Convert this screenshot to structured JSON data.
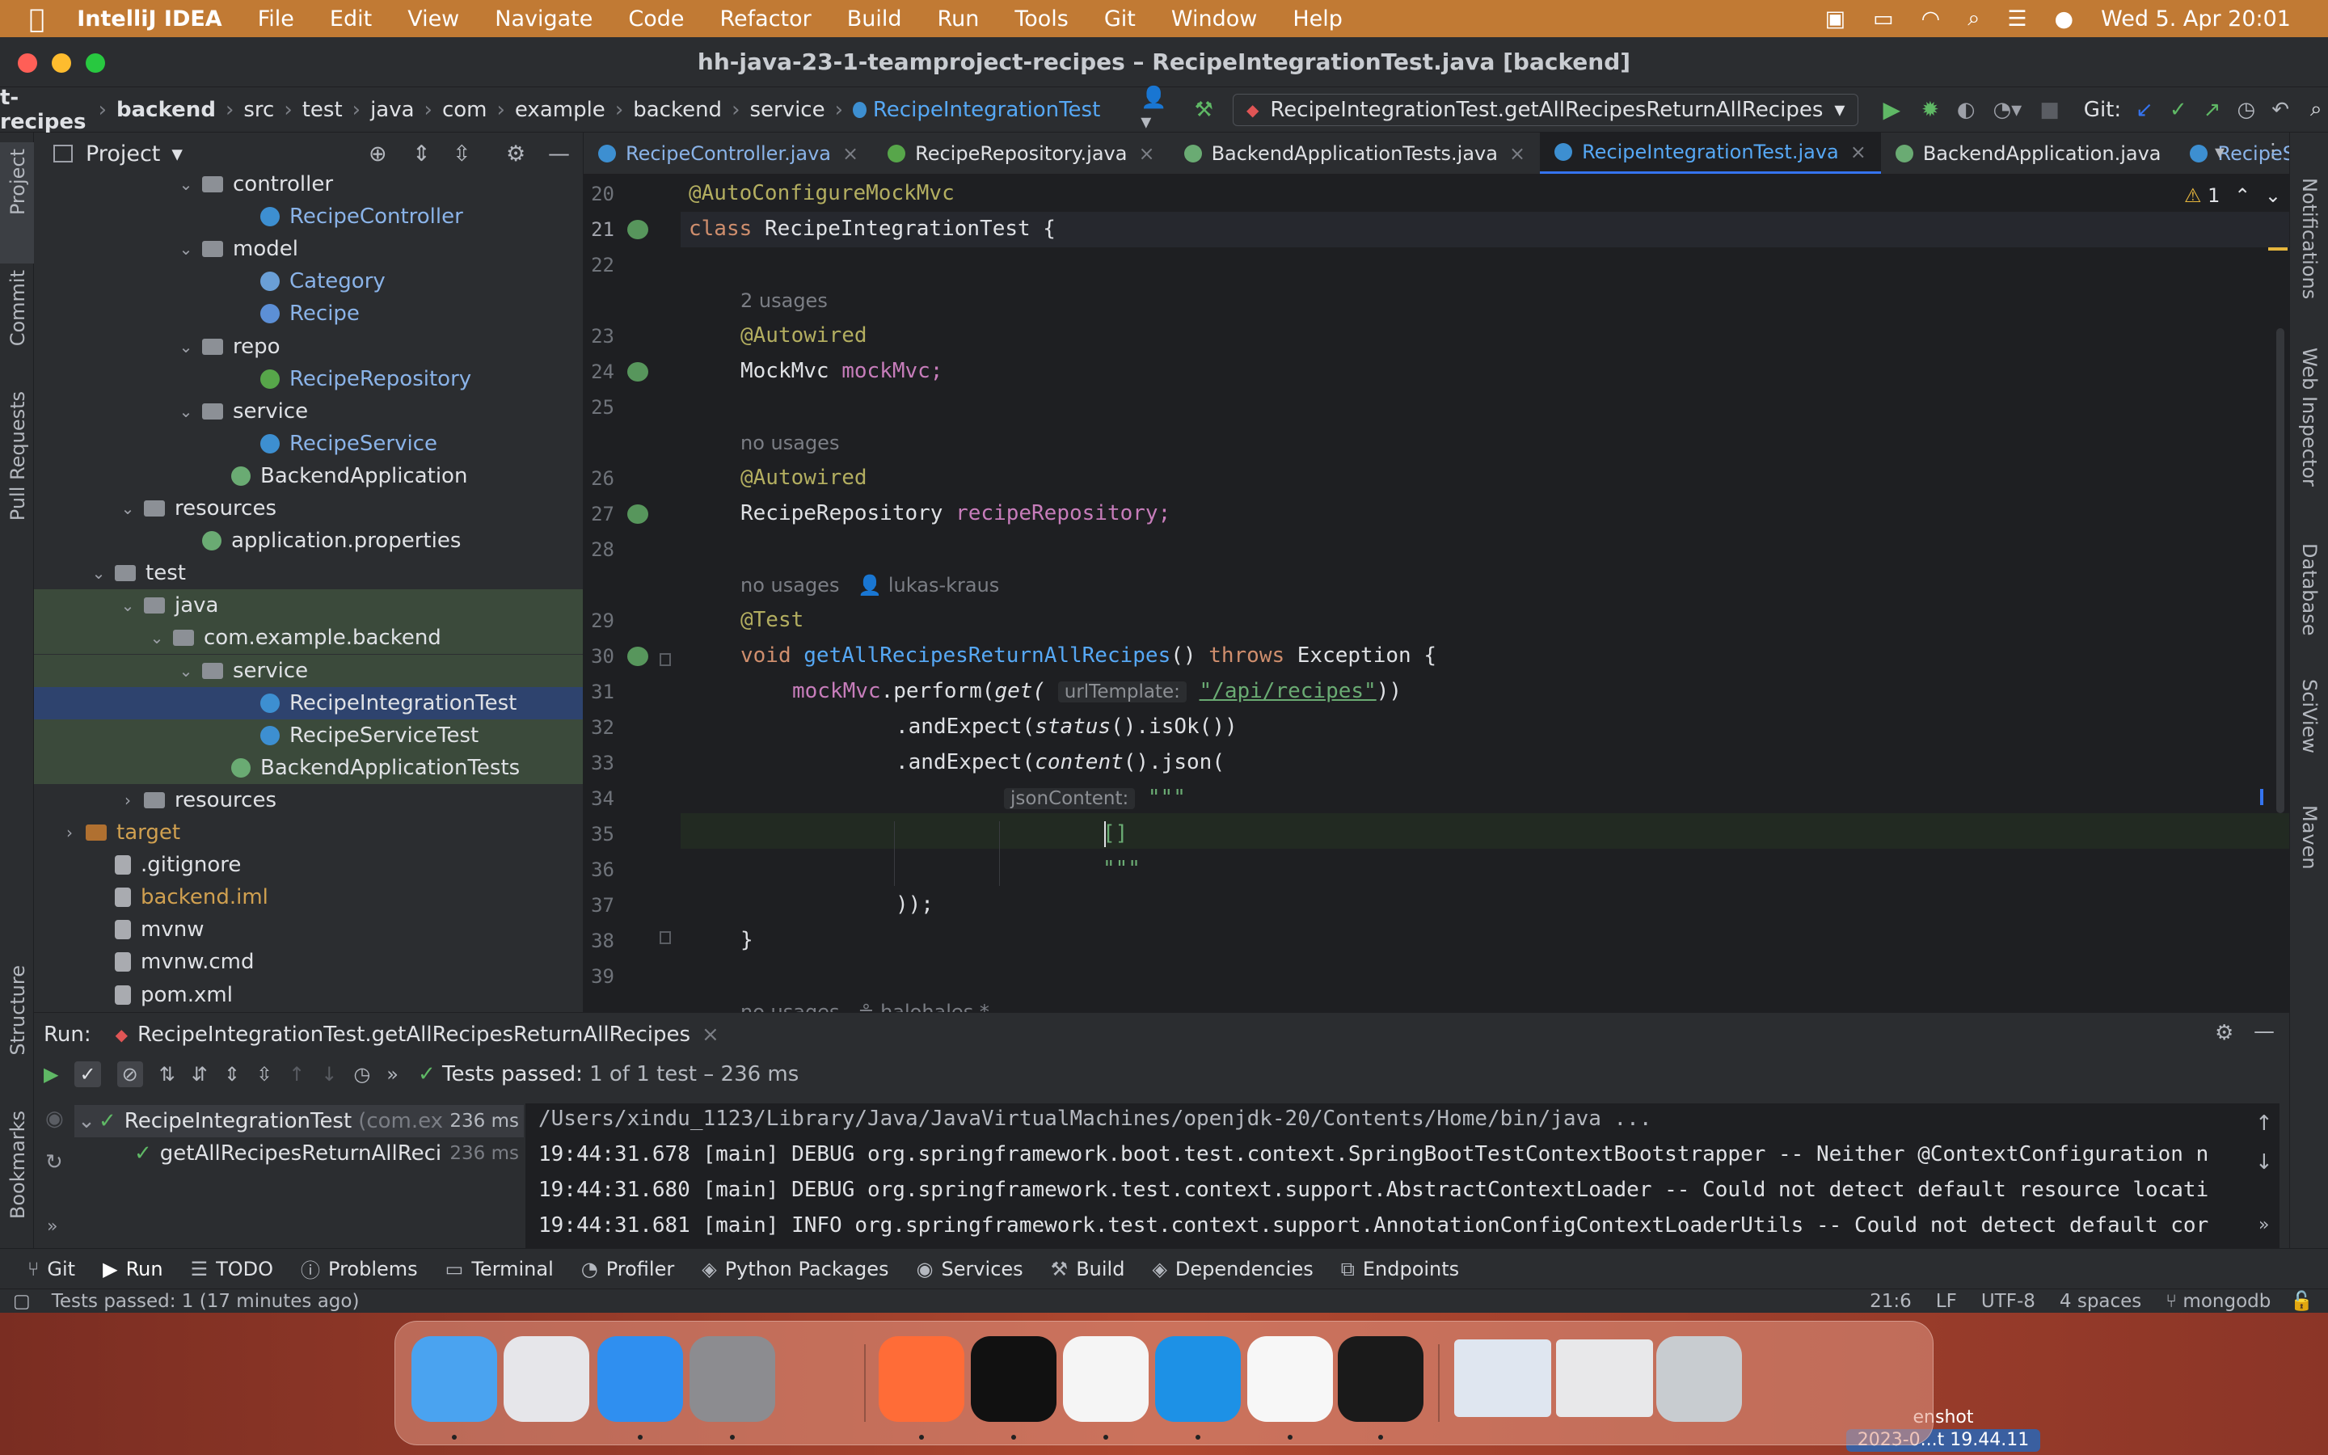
{
  "menubar": {
    "app": "IntelliJ IDEA",
    "items": [
      "File",
      "Edit",
      "View",
      "Navigate",
      "Code",
      "Refactor",
      "Build",
      "Run",
      "Tools",
      "Git",
      "Window",
      "Help"
    ],
    "datetime": "Wed 5. Apr  20:01"
  },
  "window": {
    "title": "hh-java-23-1-teamproject-recipes – RecipeIntegrationTest.java [backend]"
  },
  "navbar": {
    "crumbs": [
      "t-recipes",
      "backend",
      "src",
      "test",
      "java",
      "com",
      "example",
      "backend",
      "service",
      "RecipeIntegrationTest"
    ],
    "run_config": "RecipeIntegrationTest.getAllRecipesReturnAllRecipes",
    "git_label": "Git:"
  },
  "left_tools": {
    "project": "Project",
    "commit": "Commit",
    "pull_requests": "Pull Requests",
    "structure": "Structure",
    "bookmarks": "Bookmarks"
  },
  "right_tools": {
    "notifications": "Notifications",
    "web_inspector": "Web Inspector",
    "database": "Database",
    "sciview": "SciView",
    "maven": "Maven"
  },
  "project": {
    "title": "Project",
    "tree": [
      {
        "label": "controller",
        "type": "folder",
        "depth": 6,
        "open": true
      },
      {
        "label": "RecipeController",
        "type": "cls",
        "depth": 8
      },
      {
        "label": "model",
        "type": "folder",
        "depth": 6,
        "open": true
      },
      {
        "label": "Category",
        "type": "enum",
        "depth": 8
      },
      {
        "label": "Recipe",
        "type": "rec",
        "depth": 8
      },
      {
        "label": "repo",
        "type": "folder",
        "depth": 6,
        "open": true
      },
      {
        "label": "RecipeRepository",
        "type": "iface",
        "depth": 8
      },
      {
        "label": "service",
        "type": "folder",
        "depth": 6,
        "open": true
      },
      {
        "label": "RecipeService",
        "type": "cls",
        "depth": 8
      },
      {
        "label": "BackendApplication",
        "type": "spring",
        "depth": 7
      },
      {
        "label": "resources",
        "type": "folder",
        "depth": 4,
        "open": true
      },
      {
        "label": "application.properties",
        "type": "spring",
        "depth": 6
      },
      {
        "label": "test",
        "type": "folder",
        "depth": 3,
        "open": true
      },
      {
        "label": "java",
        "type": "folder",
        "depth": 4,
        "open": true
      },
      {
        "label": "com.example.backend",
        "type": "folder",
        "depth": 5,
        "open": true
      },
      {
        "label": "service",
        "type": "folder",
        "depth": 6,
        "open": true
      },
      {
        "label": "RecipeIntegrationTest",
        "type": "cls",
        "depth": 8
      },
      {
        "label": "RecipeServiceTest",
        "type": "cls",
        "depth": 8
      },
      {
        "label": "BackendApplicationTests",
        "type": "spring",
        "depth": 7
      },
      {
        "label": "resources",
        "type": "folder",
        "depth": 4,
        "open": false
      },
      {
        "label": "target",
        "type": "folder-orange",
        "depth": 2,
        "open": false
      },
      {
        "label": ".gitignore",
        "type": "file",
        "depth": 3
      },
      {
        "label": "backend.iml",
        "type": "file",
        "depth": 3
      },
      {
        "label": "mvnw",
        "type": "file",
        "depth": 3
      },
      {
        "label": "mvnw.cmd",
        "type": "file",
        "depth": 3
      },
      {
        "label": "pom.xml",
        "type": "file",
        "depth": 3
      }
    ]
  },
  "tabs": [
    {
      "label": "RecipeController.java",
      "color": "#3d8fd1"
    },
    {
      "label": "RecipeRepository.java",
      "color": "#57a64a"
    },
    {
      "label": "BackendApplicationTests.java",
      "color": "#6aab73"
    },
    {
      "label": "RecipeIntegrationTest.java",
      "color": "#3d8fd1",
      "active": true
    },
    {
      "label": "BackendApplication.java",
      "color": "#6aab73",
      "noclose": true
    },
    {
      "label": "RecipeServic",
      "color": "#3d8fd1",
      "noclose": true
    }
  ],
  "editor": {
    "warning_count": "1",
    "lines": [
      "20",
      "21",
      "22",
      "",
      "23",
      "24",
      "25",
      "",
      "26",
      "27",
      "28",
      "",
      "29",
      "30",
      "31",
      "32",
      "33",
      "34",
      "35",
      "36",
      "37",
      "38",
      "39"
    ],
    "usages_2": "2 usages",
    "no_usages_1": "no usages",
    "no_usages_2": "no usages",
    "author": "lukas-kraus",
    "l20": "@AutoConfigureMockMvc",
    "l21_kw": "class",
    "l21_name": "RecipeIntegrationTest {",
    "l23": "@Autowired",
    "l24_type": "MockMvc",
    "l24_field": "mockMvc;",
    "l26": "@Autowired",
    "l27_type": "RecipeRepository",
    "l27_field": "recipeRepository;",
    "l29": "@Test",
    "l30_void": "void",
    "l30_name": "getAllRecipesReturnAllRecipes",
    "l30_paren": "()",
    "l30_throws": "throws",
    "l30_rest": "Exception {",
    "l31_field": "mockMvc",
    "l31_a": ".perform(",
    "l31_get": "get(",
    "l31_hint": "urlTemplate:",
    "l31_str": "\"/api/recipes\"",
    "l31_end": "))",
    "l32_a": ".andExpect(",
    "l32_b": "status",
    "l32_c": "().isOk())",
    "l33_a": ".andExpect(",
    "l33_b": "content",
    "l33_c": "().json(",
    "l34_hint": "jsonContent:",
    "l34_str": "\"\"\"",
    "l35": "[]",
    "l36": "\"\"\"",
    "l37": "));",
    "l38": "}",
    "l39_hint": "no usages   ≗ halohales *"
  },
  "run": {
    "label": "Run:",
    "config": "RecipeIntegrationTest.getAllRecipesReturnAllRecipes",
    "passed_bold": "Tests passed:",
    "passed_rest": "1 of 1 test – 236 ms",
    "tree_root": "RecipeIntegrationTest",
    "tree_root_pkg": "(com.ex",
    "tree_root_time": "236 ms",
    "tree_child": "getAllRecipesReturnAllReci",
    "tree_child_time": "236 ms",
    "console": [
      "/Users/xindu_1123/Library/Java/JavaVirtualMachines/openjdk-20/Contents/Home/bin/java ...",
      "19:44:31.678 [main] DEBUG org.springframework.boot.test.context.SpringBootTestContextBootstrapper -- Neither @ContextConfiguration n",
      "19:44:31.680 [main] DEBUG org.springframework.test.context.support.AbstractContextLoader -- Could not detect default resource locati",
      "19:44:31.681 [main] INFO org.springframework.test.context.support.AnnotationConfigContextLoaderUtils -- Could not detect default cor"
    ]
  },
  "bottom_tabs": [
    "Git",
    "Run",
    "TODO",
    "Problems",
    "Terminal",
    "Profiler",
    "Python Packages",
    "Services",
    "Build",
    "Dependencies",
    "Endpoints"
  ],
  "status": {
    "message": "Tests passed: 1 (17 minutes ago)",
    "position": "21:6",
    "line_sep": "LF",
    "encoding": "UTF-8",
    "indent": "4 spaces",
    "branch": "mongodb"
  },
  "desktop": {
    "dock_apps": [
      {
        "name": "finder",
        "color": "#4aa3f0"
      },
      {
        "name": "launchpad",
        "color": "#e6e6ea"
      },
      {
        "name": "safari",
        "color": "#2f8ff0"
      },
      {
        "name": "system-settings",
        "color": "#8c8c90"
      },
      {
        "name": "postman",
        "color": "#ff6c37"
      },
      {
        "name": "terminal",
        "color": "#111111"
      },
      {
        "name": "slack",
        "color": "#f5f5f5"
      },
      {
        "name": "docker",
        "color": "#1d91e6"
      },
      {
        "name": "mongodb-compass",
        "color": "#f7f7f7"
      },
      {
        "name": "intellij",
        "color": "#1a1a1a"
      },
      {
        "name": "preview-1",
        "color": "#dfe6f0"
      },
      {
        "name": "preview-2",
        "color": "#e8e8ea"
      },
      {
        "name": "trash",
        "color": "#c8ccd0"
      }
    ],
    "screenshot_label": "enshot",
    "screenshot_time": "2023-0...t 19.44.11"
  },
  "colors": {
    "accent": "#3574f0",
    "menubar": "#c17a34",
    "success": "#5fb865"
  }
}
